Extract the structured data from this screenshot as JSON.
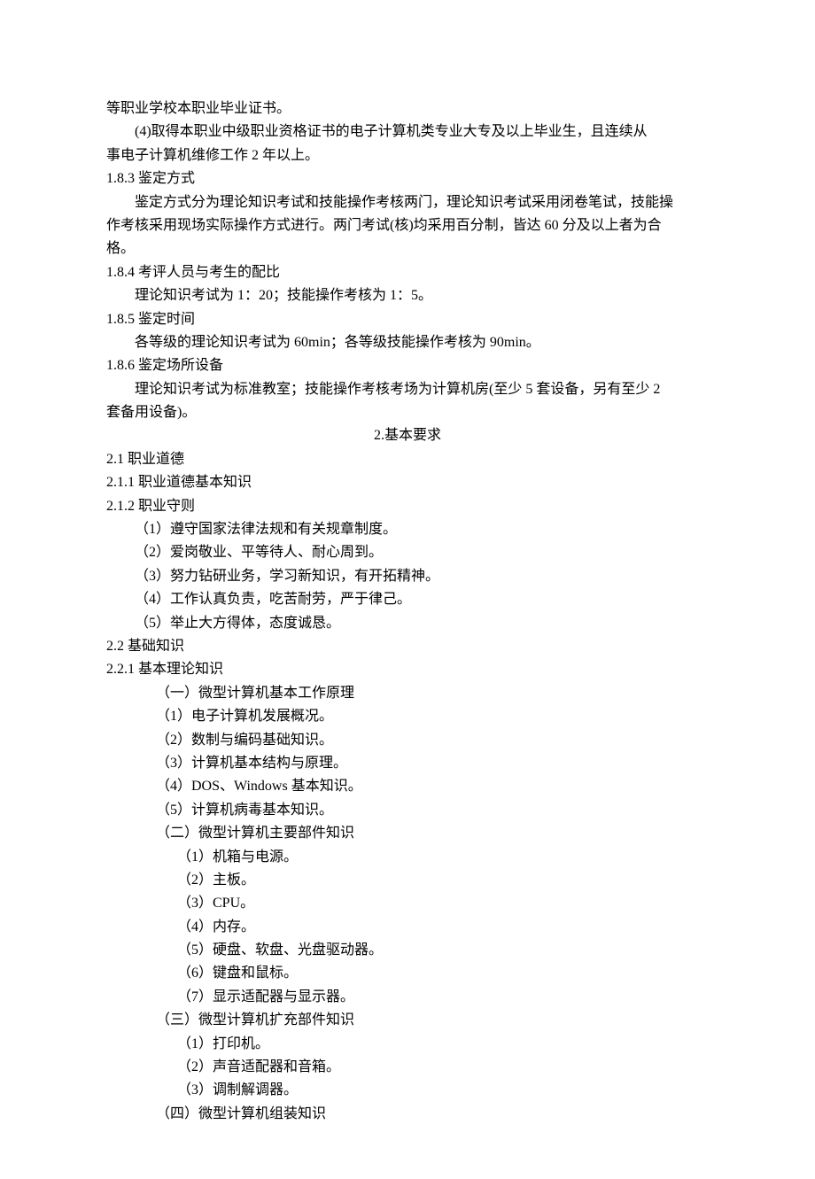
{
  "lines": [
    {
      "cls": "p",
      "text": "等职业学校本职业毕业证书。"
    },
    {
      "cls": "p indent2",
      "text": "(4)取得本职业中级职业资格证书的电子计算机类专业大专及以上毕业生，且连续从"
    },
    {
      "cls": "p",
      "text": "事电子计算机维修工作 2 年以上。"
    },
    {
      "cls": "p",
      "text": "1.8.3  鉴定方式"
    },
    {
      "cls": "p indent1",
      "text": "鉴定方式分为理论知识考试和技能操作考核两门，理论知识考试采用闭卷笔试，技能操"
    },
    {
      "cls": "p",
      "text": "作考核采用现场实际操作方式进行。两门考试(核)均采用百分制，皆达 60 分及以上者为合"
    },
    {
      "cls": "p",
      "text": "格。"
    },
    {
      "cls": "p",
      "text": "1.8.4  考评人员与考生的配比"
    },
    {
      "cls": "p indent1",
      "text": "理论知识考试为 1：20；技能操作考核为 1：5。"
    },
    {
      "cls": "p",
      "text": "  1.8.5  鉴定时间"
    },
    {
      "cls": "p indent2",
      "text": "各等级的理论知识考试为 60min；各等级技能操作考核为 90min。"
    },
    {
      "cls": "p",
      "text": "  1.8.6  鉴定场所设备"
    },
    {
      "cls": "p indent2",
      "text": "理论知识考试为标准教室；技能操作考核考场为计算机房(至少 5 套设备，另有至少 2"
    },
    {
      "cls": "p",
      "text": "  套备用设备)。"
    },
    {
      "cls": "p center",
      "text": "2.基本要求"
    },
    {
      "cls": "p",
      "text": "  2.1  职业道德"
    },
    {
      "cls": "p",
      "text": "  2.1.1  职业道德基本知识"
    },
    {
      "cls": "p",
      "text": "  2.1.2  职业守则"
    },
    {
      "cls": "p indent2",
      "text": "（1）遵守国家法律法规和有关规章制度。"
    },
    {
      "cls": "p indent2",
      "text": "（2）爱岗敬业、平等待人、耐心周到。"
    },
    {
      "cls": "p indent2",
      "text": "（3）努力钻研业务，学习新知识，有开拓精神。"
    },
    {
      "cls": "p indent2",
      "text": "（4）工作认真负责，吃苦耐劳，严于律己。"
    },
    {
      "cls": "p indent2",
      "text": "（5）举止大方得体，态度诚恳。"
    },
    {
      "cls": "p",
      "text": "  2.2  基础知识"
    },
    {
      "cls": "p",
      "text": "  2.2.1  基本理论知识"
    },
    {
      "cls": "p indent3",
      "text": "（一）微型计算机基本工作原理"
    },
    {
      "cls": "p indent3",
      "text": "（1）电子计算机发展概况。"
    },
    {
      "cls": "p indent3",
      "text": "（2）数制与编码基础知识。"
    },
    {
      "cls": "p indent3",
      "text": "（3）计算机基本结构与原理。"
    },
    {
      "cls": "p indent3",
      "text": "（4）DOS、Windows 基本知识。"
    },
    {
      "cls": "p indent3",
      "text": "（5）计算机病毒基本知识。"
    },
    {
      "cls": "p indent3",
      "text": "（二）微型计算机主要部件知识"
    },
    {
      "cls": "p indent4",
      "text": "（1）机箱与电源。"
    },
    {
      "cls": "p indent4",
      "text": "（2）主板。"
    },
    {
      "cls": "p indent4",
      "text": "（3）CPU。"
    },
    {
      "cls": "p indent4",
      "text": "（4）内存。"
    },
    {
      "cls": "p indent4",
      "text": "（5）硬盘、软盘、光盘驱动器。"
    },
    {
      "cls": "p indent4",
      "text": "（6）键盘和鼠标。"
    },
    {
      "cls": "p indent4",
      "text": "（7）显示适配器与显示器。"
    },
    {
      "cls": "p indent3",
      "text": "（三）微型计算机扩充部件知识"
    },
    {
      "cls": "p indent4",
      "text": "（1）打印机。"
    },
    {
      "cls": "p indent4",
      "text": "（2）声音适配器和音箱。"
    },
    {
      "cls": "p indent4",
      "text": "（3）调制解调器。"
    },
    {
      "cls": "p indent3",
      "text": "（四）微型计算机组装知识"
    }
  ]
}
